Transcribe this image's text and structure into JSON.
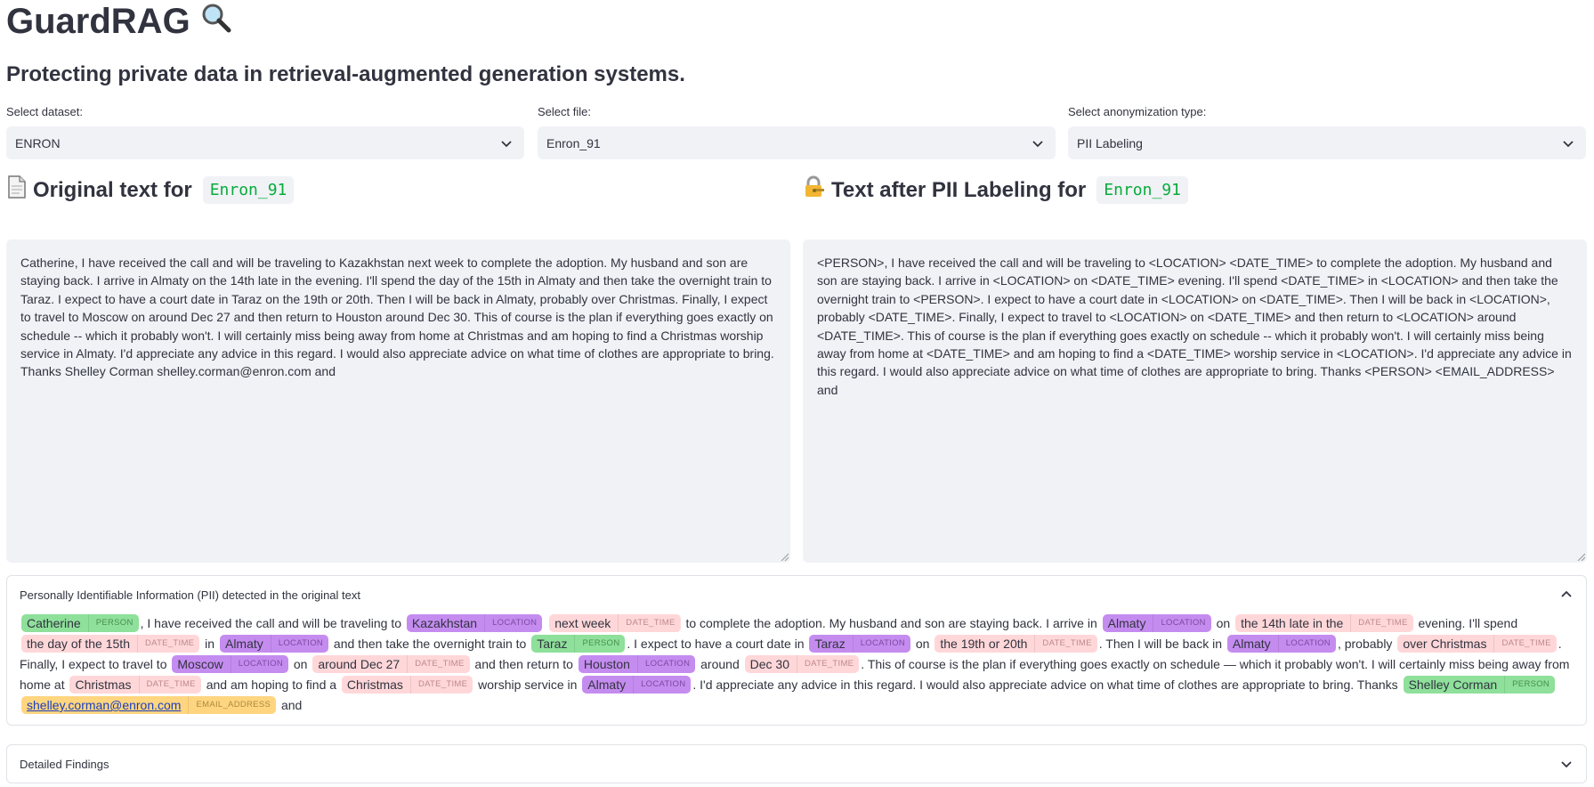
{
  "header": {
    "title": "GuardRAG",
    "title_icon": "magnifier-icon",
    "subtitle": "Protecting private data in retrieval-augmented generation systems."
  },
  "selectors": {
    "dataset": {
      "label": "Select dataset:",
      "value": "ENRON"
    },
    "file": {
      "label": "Select file:",
      "value": "Enron_91"
    },
    "anonymization": {
      "label": "Select anonymization type:",
      "value": "PII Labeling"
    }
  },
  "original": {
    "heading_icon": "page-icon",
    "heading": "Original text for",
    "file_chip": "Enron_91",
    "text": "Catherine, I have received the call and will be traveling to Kazakhstan next week to complete the adoption. My husband and son are staying back. I arrive in Almaty on the 14th late in the evening. I'll spend the day of the 15th in Almaty and then take the overnight train to Taraz. I expect to have a court date in Taraz on the 19th or 20th. Then I will be back in Almaty, probably over Christmas. Finally, I expect to travel to Moscow on around Dec 27 and then return to Houston around Dec 30. This of course is the plan if everything goes exactly on schedule -- which it probably won't. I will certainly miss being away from home at Christmas and am hoping to find a Christmas worship service in Almaty. I'd appreciate any advice in this regard. I would also appreciate advice on what time of clothes are appropriate to bring. Thanks Shelley Corman shelley.corman@enron.com and"
  },
  "anonymized": {
    "heading_icon": "lock-key-icon",
    "heading": "Text after PII Labeling for",
    "file_chip": "Enron_91",
    "text": "<PERSON>, I have received the call and will be traveling to <LOCATION> <DATE_TIME> to complete the adoption. My husband and son are staying back. I arrive in <LOCATION> on <DATE_TIME> evening. I'll spend <DATE_TIME> in <LOCATION> and then take the overnight train to <PERSON>. I expect to have a court date in <LOCATION> on <DATE_TIME>. Then I will be back in <LOCATION>, probably <DATE_TIME>. Finally, I expect to travel to <LOCATION> on <DATE_TIME> and then return to <LOCATION> around <DATE_TIME>. This of course is the plan if everything goes exactly on schedule -- which it probably won't. I will certainly miss being away from home at <DATE_TIME> and am hoping to find a <DATE_TIME> worship service in <LOCATION>. I'd appreciate any advice in this regard. I would also appreciate advice on what time of clothes are appropriate to bring. Thanks <PERSON> <EMAIL_ADDRESS> and"
  },
  "pii_panel": {
    "title": "Personally Identifiable Information (PII) detected in the original text",
    "segments": [
      {
        "entity": "Catherine",
        "type": "PERSON"
      },
      {
        "text": ", I have received the call and will be traveling to "
      },
      {
        "entity": "Kazakhstan",
        "type": "LOCATION"
      },
      {
        "text": " "
      },
      {
        "entity": "next week",
        "type": "DATE_TIME"
      },
      {
        "text": " to complete the adoption. My husband and son are staying back. I arrive in "
      },
      {
        "entity": "Almaty",
        "type": "LOCATION"
      },
      {
        "text": " on "
      },
      {
        "entity": "the 14th late in the",
        "type": "DATE_TIME"
      },
      {
        "text": " evening. I'll spend "
      },
      {
        "entity": "the day of the 15th",
        "type": "DATE_TIME"
      },
      {
        "text": " in "
      },
      {
        "entity": "Almaty",
        "type": "LOCATION"
      },
      {
        "text": " and then take the overnight train to "
      },
      {
        "entity": "Taraz",
        "type": "PERSON"
      },
      {
        "text": ". I expect to have a court date in "
      },
      {
        "entity": "Taraz",
        "type": "LOCATION"
      },
      {
        "text": " on "
      },
      {
        "entity": "the 19th or 20th",
        "type": "DATE_TIME"
      },
      {
        "text": ". Then I will be back in "
      },
      {
        "entity": "Almaty",
        "type": "LOCATION"
      },
      {
        "text": ", probably "
      },
      {
        "entity": "over Christmas",
        "type": "DATE_TIME"
      },
      {
        "text": ". Finally, I expect to travel to "
      },
      {
        "entity": "Moscow",
        "type": "LOCATION"
      },
      {
        "text": " on "
      },
      {
        "entity": "around Dec 27",
        "type": "DATE_TIME"
      },
      {
        "text": " and then return to "
      },
      {
        "entity": "Houston",
        "type": "LOCATION"
      },
      {
        "text": " around "
      },
      {
        "entity": "Dec 30",
        "type": "DATE_TIME"
      },
      {
        "text": ". This of course is the plan if everything goes exactly on schedule — which it probably won't. I will certainly miss being away from home at "
      },
      {
        "entity": "Christmas",
        "type": "DATE_TIME"
      },
      {
        "text": " and am hoping to find a "
      },
      {
        "entity": "Christmas",
        "type": "DATE_TIME"
      },
      {
        "text": " worship service in "
      },
      {
        "entity": "Almaty",
        "type": "LOCATION"
      },
      {
        "text": ". I'd appreciate any advice in this regard. I would also appreciate advice on what time of clothes are appropriate to bring. Thanks "
      },
      {
        "entity": "Shelley Corman",
        "type": "PERSON"
      },
      {
        "text": " "
      },
      {
        "entity": "shelley.corman@enron.com",
        "type": "EMAIL_ADDRESS"
      },
      {
        "text": " and"
      }
    ]
  },
  "findings_panel": {
    "title": "Detailed Findings"
  },
  "colors": {
    "PERSON": "#8ee09a",
    "LOCATION": "#c58cf0",
    "DATE_TIME": "#ffd7d9",
    "EMAIL_ADDRESS": "#ffd580",
    "code_text": "#09ab3b"
  }
}
